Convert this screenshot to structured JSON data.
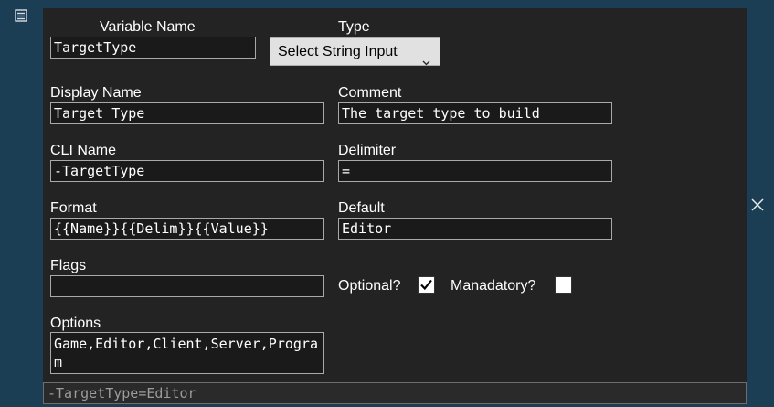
{
  "icons": {
    "drag_handle": "drag-handle-icon",
    "close": "close-icon",
    "dropdown": "chevron-down-icon",
    "checkmark": "checkmark-icon"
  },
  "labels": {
    "variable_name": "Variable Name",
    "type": "Type",
    "display_name": "Display Name",
    "comment": "Comment",
    "cli_name": "CLI Name",
    "delimiter": "Delimiter",
    "format": "Format",
    "default": "Default",
    "flags": "Flags",
    "optional": "Optional?",
    "mandatory": "Manadatory?",
    "options": "Options"
  },
  "fields": {
    "variable_name": "TargetType",
    "type_selected": "Select String Input",
    "display_name": "Target Type",
    "comment": "The target type to build",
    "cli_name": "-TargetType",
    "delimiter": "=",
    "format": "{{Name}}{{Delim}}{{Value}}",
    "default": "Editor",
    "flags": "",
    "options": "Game,Editor,Client,Server,Program"
  },
  "checkboxes": {
    "optional": true,
    "mandatory": false
  },
  "preview": "-TargetType=Editor"
}
